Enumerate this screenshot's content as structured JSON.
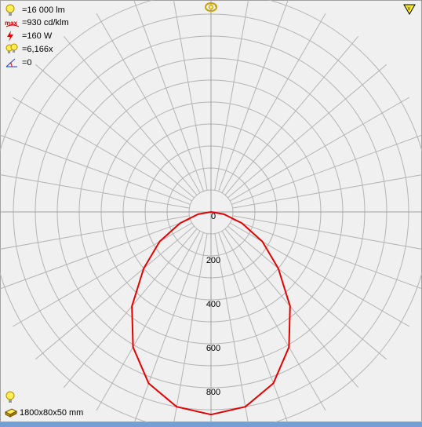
{
  "info": {
    "lumens": "=16 000 lm",
    "max_intensity": "=930 cd/klm",
    "power": "=160 W",
    "factor": "=6,166x",
    "angle": "=0"
  },
  "footer": {
    "dimensions": "1800x80x50 mm"
  },
  "icons": {
    "lumens": "lightbulb-icon",
    "max_intensity": "max-icon",
    "power": "lightning-icon",
    "factor": "lamp-cluster-icon",
    "angle": "angle-icon",
    "top_center": "rotate-icon",
    "corner": "warning-triangle-icon",
    "bottom_bulb": "lightbulb-icon",
    "dimensions": "luminaire-box-icon"
  },
  "chart_data": {
    "type": "polar",
    "radial_ticks": [
      0,
      200,
      400,
      600,
      800
    ],
    "radial_tick_labels": [
      "0",
      "200",
      "400",
      "600",
      "800"
    ],
    "radial_max": 930,
    "angular_grid_step_deg": 10,
    "series": [
      {
        "color": "#e00000",
        "angles_deg": [
          -90,
          -80,
          -70,
          -60,
          -50,
          -40,
          -30,
          -20,
          -10,
          0,
          10,
          20,
          30,
          40,
          50,
          60,
          70,
          80,
          90
        ],
        "values": [
          0,
          60,
          150,
          270,
          400,
          560,
          710,
          830,
          900,
          922,
          900,
          830,
          710,
          560,
          400,
          270,
          150,
          60,
          0
        ]
      }
    ]
  }
}
